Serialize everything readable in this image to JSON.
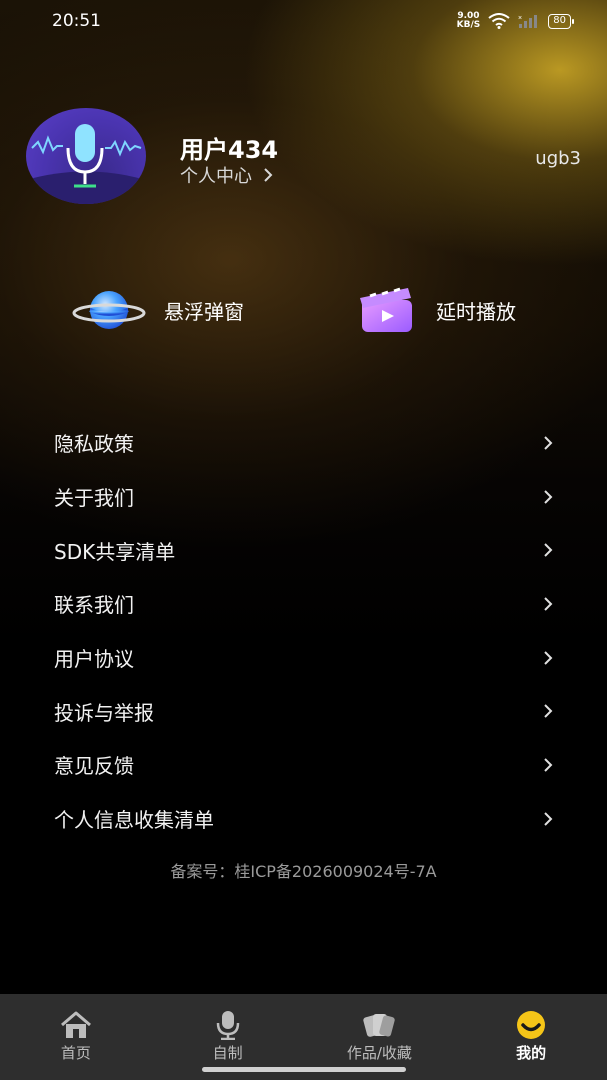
{
  "status_bar": {
    "time": "20:51",
    "net_speed_value": "9.00",
    "net_speed_unit": "KB/S",
    "battery": "80"
  },
  "profile": {
    "user_name": "用户434",
    "center_link": "个人中心",
    "user_id": "ugb3"
  },
  "features": [
    {
      "label": "悬浮弹窗",
      "icon": "planet-icon"
    },
    {
      "label": "延时播放",
      "icon": "video-clip-icon"
    }
  ],
  "menu": {
    "items": [
      {
        "label": "隐私政策"
      },
      {
        "label": "关于我们"
      },
      {
        "label": "SDK共享清单"
      },
      {
        "label": "联系我们"
      },
      {
        "label": "用户协议"
      },
      {
        "label": "投诉与举报"
      },
      {
        "label": "意见反馈"
      },
      {
        "label": "个人信息收集清单"
      }
    ]
  },
  "icp": "备案号：桂ICP备2026009024号-7A",
  "tabbar": {
    "tabs": [
      {
        "label": "首页",
        "icon": "home-icon"
      },
      {
        "label": "自制",
        "icon": "microphone-icon"
      },
      {
        "label": "作品/收藏",
        "icon": "cards-icon"
      },
      {
        "label": "我的",
        "icon": "smile-icon",
        "active": true
      }
    ],
    "active_color": "#f5c518"
  }
}
